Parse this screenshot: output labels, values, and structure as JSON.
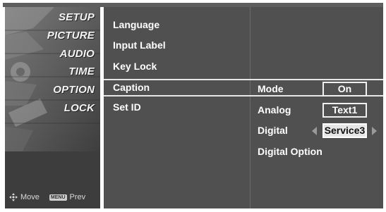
{
  "sidebar": {
    "items": [
      {
        "label": "SETUP"
      },
      {
        "label": "PICTURE"
      },
      {
        "label": "AUDIO"
      },
      {
        "label": "TIME"
      },
      {
        "label": "OPTION"
      },
      {
        "label": "LOCK"
      }
    ],
    "footer": {
      "move_label": "Move",
      "menu_key": "MENU",
      "prev_label": "Prev",
      "move_icon": "move-cross-icon"
    }
  },
  "options_menu": {
    "items": [
      {
        "label": "Language"
      },
      {
        "label": "Input Label"
      },
      {
        "label": "Key Lock"
      },
      {
        "label": "Caption"
      },
      {
        "label": "Set ID"
      }
    ],
    "selected": "Caption"
  },
  "caption_submenu": {
    "mode": {
      "label": "Mode",
      "value": "On"
    },
    "analog": {
      "label": "Analog",
      "value": "Text1"
    },
    "digital": {
      "label": "Digital",
      "value": "Service3"
    },
    "digital_option": {
      "label": "Digital Option"
    }
  },
  "colors": {
    "panel": "#505050",
    "sidebar": "#3d3d3d",
    "highlight": "#e7e7e7",
    "text": "#ffffff"
  }
}
